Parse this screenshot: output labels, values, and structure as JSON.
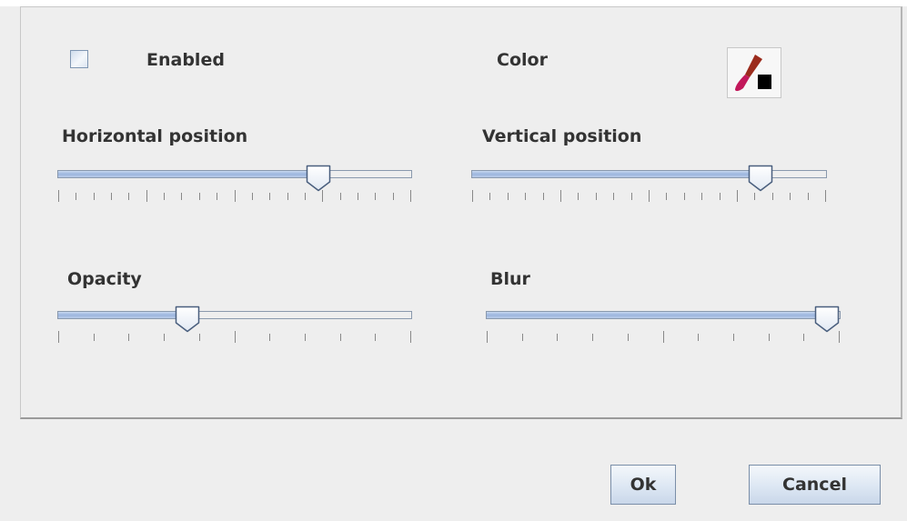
{
  "enabled": {
    "label": "Enabled",
    "checked": false
  },
  "color": {
    "label": "Color",
    "button_icon": "paintbrush-icon",
    "selected_color": "#000000",
    "brush_color": "#c2185b"
  },
  "sliders": {
    "horizontal": {
      "label": "Horizontal position",
      "value_fraction": 0.755,
      "ticks": 21
    },
    "vertical": {
      "label": "Vertical position",
      "value_fraction": 0.84,
      "ticks": 21
    },
    "opacity": {
      "label": "Opacity",
      "value_fraction": 0.355,
      "ticks": 11
    },
    "blur": {
      "label": "Blur",
      "value_fraction": 1.0,
      "ticks": 11
    }
  },
  "buttons": {
    "ok": "Ok",
    "cancel": "Cancel"
  }
}
